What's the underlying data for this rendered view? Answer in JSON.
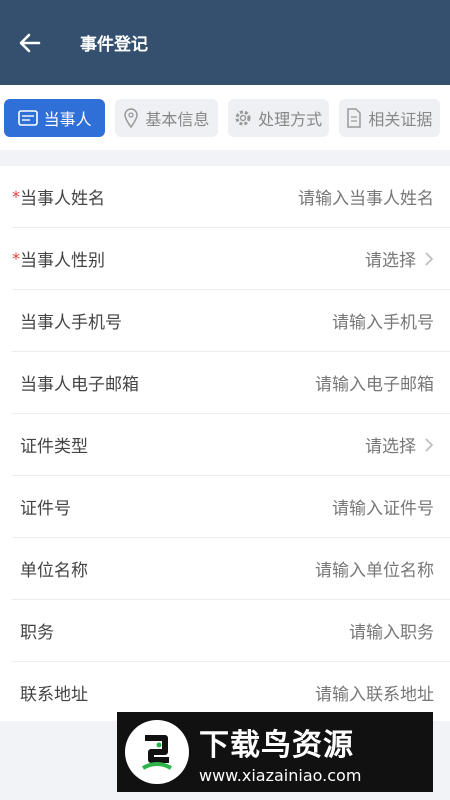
{
  "header": {
    "title": "事件登记",
    "back_icon": "arrow-left-icon"
  },
  "tabs": [
    {
      "label": "当事人",
      "icon": "card-icon",
      "active": true
    },
    {
      "label": "基本信息",
      "icon": "location-pin-icon",
      "active": false
    },
    {
      "label": "处理方式",
      "icon": "gear-icon",
      "active": false
    },
    {
      "label": "相关证据",
      "icon": "document-icon",
      "active": false
    }
  ],
  "form": {
    "rows": [
      {
        "label": "当事人姓名",
        "required": true,
        "value": "请输入当事人姓名",
        "type": "input"
      },
      {
        "label": "当事人性别",
        "required": true,
        "value": "请选择",
        "type": "select"
      },
      {
        "label": "当事人手机号",
        "required": false,
        "value": "请输入手机号",
        "type": "input"
      },
      {
        "label": "当事人电子邮箱",
        "required": false,
        "value": "请输入电子邮箱",
        "type": "input"
      },
      {
        "label": "证件类型",
        "required": false,
        "value": "请选择",
        "type": "select"
      },
      {
        "label": "证件号",
        "required": false,
        "value": "请输入证件号",
        "type": "input"
      },
      {
        "label": "单位名称",
        "required": false,
        "value": "请输入单位名称",
        "type": "input"
      },
      {
        "label": "职务",
        "required": false,
        "value": "请输入职务",
        "type": "input"
      },
      {
        "label": "联系地址",
        "required": false,
        "value": "请输入联系地址",
        "type": "input"
      }
    ],
    "required_mark": "*"
  },
  "watermark": {
    "main": "下载鸟资源",
    "url": "www.xiazainiao.com"
  },
  "colors": {
    "header": "#34506e",
    "accent": "#2f6fd8",
    "required": "#e23b3b"
  }
}
